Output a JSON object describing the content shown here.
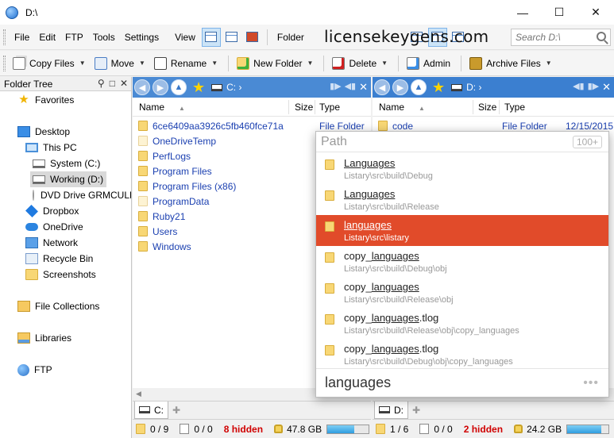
{
  "window": {
    "title": "D:\\"
  },
  "menu": {
    "items": [
      "File",
      "Edit",
      "FTP",
      "Tools",
      "Settings",
      "View",
      "Folder"
    ],
    "search_placeholder": "Search D:\\"
  },
  "watermark": "licensekeygens.com",
  "toolbar": {
    "copy_files": "Copy Files",
    "move": "Move",
    "rename": "Rename",
    "new_folder": "New Folder",
    "delete": "Delete",
    "admin": "Admin",
    "archive_files": "Archive Files"
  },
  "tree": {
    "title": "Folder Tree",
    "favorites": "Favorites",
    "desktop": "Desktop",
    "this_pc": "This PC",
    "system_c": "System (C:)",
    "working_d": "Working (D:)",
    "dvd": "DVD Drive GRMCULFRE",
    "dropbox": "Dropbox",
    "onedrive": "OneDrive",
    "network": "Network",
    "recycle_bin": "Recycle Bin",
    "screenshots": "Screenshots",
    "file_collections": "File Collections",
    "libraries": "Libraries",
    "ftp": "FTP"
  },
  "left_pane": {
    "path": "C:",
    "columns": {
      "name": "Name",
      "size": "Size",
      "type": "Type"
    },
    "files": [
      {
        "name": "6ce6409aa3926c5fb460fce71a",
        "type": "File Folder"
      },
      {
        "name": "OneDriveTemp",
        "type": ""
      },
      {
        "name": "PerfLogs",
        "type": ""
      },
      {
        "name": "Program Files",
        "type": ""
      },
      {
        "name": "Program Files (x86)",
        "type": ""
      },
      {
        "name": "ProgramData",
        "type": ""
      },
      {
        "name": "Ruby21",
        "type": ""
      },
      {
        "name": "Users",
        "type": ""
      },
      {
        "name": "Windows",
        "type": ""
      }
    ],
    "tab_label": "C:",
    "status": {
      "folders": "0 / 9",
      "files": "0 / 0",
      "hidden": "8 hidden",
      "free": "47.8 GB",
      "free_fraction": 0.66
    }
  },
  "right_pane": {
    "path": "D:",
    "columns": {
      "name": "Name",
      "size": "Size",
      "type": "Type"
    },
    "files": [
      {
        "name": "code",
        "type": "File Folder",
        "date": "12/15/2015"
      }
    ],
    "tab_label": "D:",
    "status": {
      "folders": "1 / 6",
      "files": "0 / 0",
      "hidden": "2 hidden",
      "free": "24.2 GB",
      "free_fraction": 0.82
    }
  },
  "popup": {
    "header": "Path",
    "count": "100+",
    "query": "languages",
    "dots": "•••",
    "results": [
      {
        "pre": "",
        "match": "Languages",
        "post": "",
        "path": "Listary\\src\\build\\Debug"
      },
      {
        "pre": "",
        "match": "Languages",
        "post": "",
        "path": "Listary\\src\\build\\Release"
      },
      {
        "pre": "",
        "match": "languages",
        "post": "",
        "path": "Listary\\src\\listary",
        "highlighted": true
      },
      {
        "pre": "copy_",
        "match": "languages",
        "post": "",
        "path": "Listary\\src\\build\\Debug\\obj"
      },
      {
        "pre": "copy_",
        "match": "languages",
        "post": "",
        "path": "Listary\\src\\build\\Release\\obj"
      },
      {
        "pre": "copy_",
        "match": "languages",
        "post": ".tlog",
        "path": "Listary\\src\\build\\Release\\obj\\copy_languages"
      },
      {
        "pre": "copy_",
        "match": "languages",
        "post": ".tlog",
        "path": "Listary\\src\\build\\Debug\\obj\\copy_languages"
      }
    ]
  }
}
